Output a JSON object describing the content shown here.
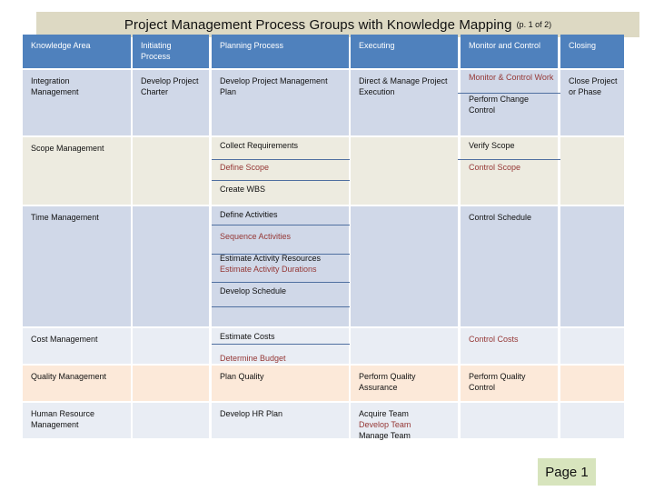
{
  "title": {
    "main": "Project Management Process Groups with Knowledge Mapping",
    "page_ref": "(p. 1 of  2)"
  },
  "table": {
    "headers": [
      "Knowledge Area",
      "Initiating Process",
      "Planning Process",
      "Executing",
      "Monitor and Control",
      "Closing"
    ],
    "rows": [
      {
        "area": "Integration Management",
        "initiating": [
          "Develop Project Charter"
        ],
        "planning": [
          "Develop Project Management Plan"
        ],
        "executing": [
          "Direct  & Manage Project Execution"
        ],
        "monitor": [
          "Monitor & Control Work",
          "Perform Change Control"
        ],
        "closing": [
          "Close Project or Phase"
        ]
      },
      {
        "area": "Scope Management",
        "initiating": [],
        "planning": [
          "Collect Requirements",
          "Define Scope",
          "Create WBS"
        ],
        "executing": [],
        "monitor": [
          "Verify Scope",
          "Control Scope"
        ],
        "closing": []
      },
      {
        "area": "Time Management",
        "initiating": [],
        "planning": [
          "Define Activities",
          "Sequence Activities",
          "Estimate Activity Resources",
          "Estimate Activity Durations",
          "Develop Schedule"
        ],
        "executing": [],
        "monitor": [
          "Control Schedule"
        ],
        "closing": []
      },
      {
        "area": "Cost Management",
        "initiating": [],
        "planning": [
          "Estimate Costs",
          "Determine Budget"
        ],
        "executing": [],
        "monitor": [
          "Control Costs"
        ],
        "closing": []
      },
      {
        "area": "Quality Management",
        "initiating": [],
        "planning": [
          "Plan Quality"
        ],
        "executing": [
          "Perform Quality Assurance"
        ],
        "monitor": [
          "Perform Quality Control"
        ],
        "closing": []
      },
      {
        "area": "Human Resource Management",
        "initiating": [],
        "planning": [
          "Develop HR Plan"
        ],
        "executing": [
          "Acquire Team",
          "Develop Team",
          "Manage Team"
        ],
        "monitor": [],
        "closing": []
      }
    ]
  },
  "colors": {
    "header_blue": "#4f81bd",
    "highlight_red": "#953735",
    "banner": "#ddd9c3",
    "page_badge": "#d7e4bd"
  },
  "footer": {
    "page_label": "Page 1"
  }
}
